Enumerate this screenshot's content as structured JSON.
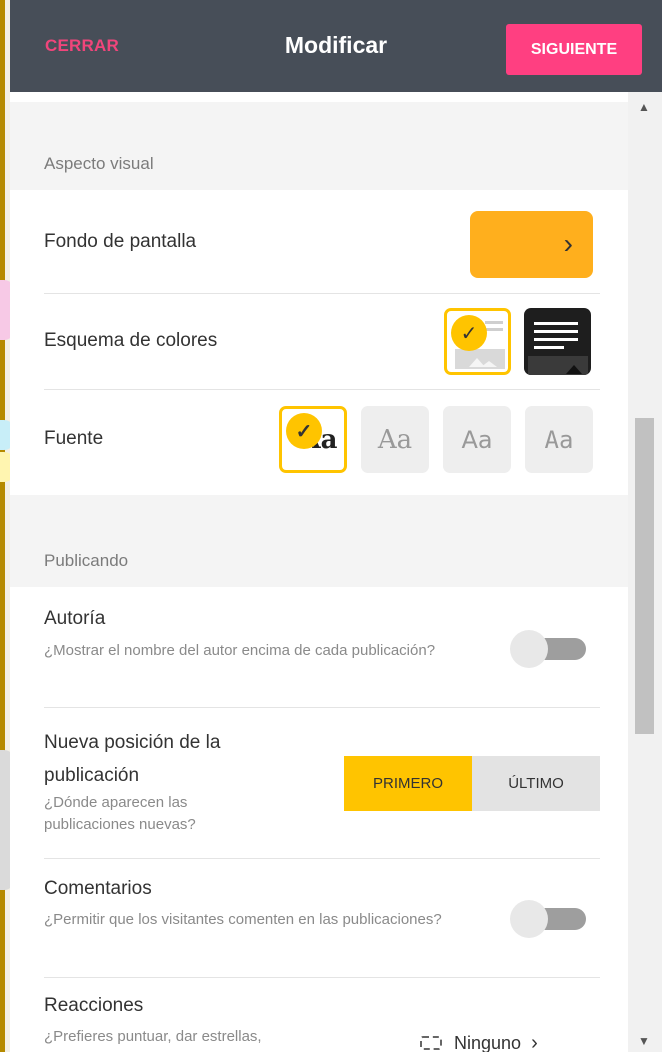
{
  "header": {
    "close_label": "CERRAR",
    "title": "Modificar",
    "next_label": "SIGUIENTE"
  },
  "visual_section": {
    "heading": "Aspecto visual",
    "wallpaper_label": "Fondo de pantalla",
    "wallpaper_color": "#ffaf1d",
    "color_scheme_label": "Esquema de colores",
    "color_schemes": [
      "light",
      "dark"
    ],
    "selected_color_scheme": "light",
    "font_label": "Fuente",
    "font_options": [
      "Aa",
      "Aa",
      "Aa",
      "Aa"
    ],
    "selected_font": 0
  },
  "publishing_section": {
    "heading": "Publicando",
    "authorship": {
      "label": "Autoría",
      "description": "¿Mostrar el nombre del autor encima de cada publicación?",
      "enabled": false
    },
    "new_post_position": {
      "label": "Nueva posición de la publicación",
      "description": "¿Dónde aparecen las publicaciones nuevas?",
      "options": [
        "PRIMERO",
        "ÚLTIMO"
      ],
      "selected": "PRIMERO"
    },
    "comments": {
      "label": "Comentarios",
      "description": "¿Permitir que los visitantes comenten en las publicaciones?",
      "enabled": false
    },
    "reactions": {
      "label": "Reacciones",
      "description": "¿Prefieres puntuar, dar estrellas,",
      "value": "Ninguno"
    }
  },
  "colors": {
    "accent_yellow": "#ffc400",
    "header_bg": "#474e58",
    "pink": "#ff3f81"
  }
}
